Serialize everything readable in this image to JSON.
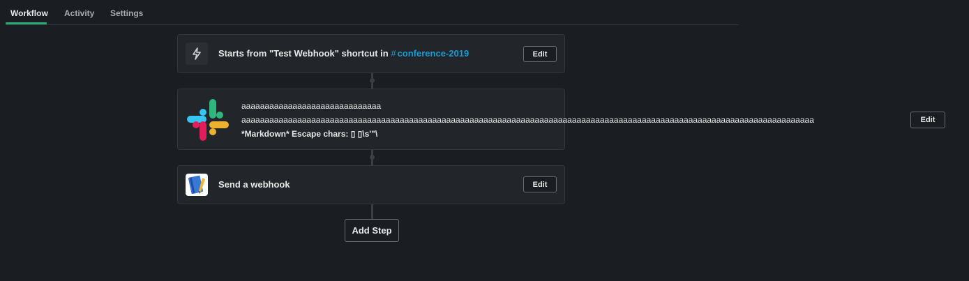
{
  "tabs": [
    {
      "label": "Workflow",
      "active": true
    },
    {
      "label": "Activity",
      "active": false
    },
    {
      "label": "Settings",
      "active": false
    }
  ],
  "steps": [
    {
      "icon": "lightning-bolt-icon",
      "title_prefix": "Starts from \"Test Webhook\" shortcut in",
      "channel_hash": "#",
      "channel_name": "conference-2019",
      "edit_label": "Edit"
    },
    {
      "icon": "slack-logo-icon",
      "lines": [
        "aaaaaaaaaaaaaaaaaaaaaaaaaaaaaa",
        "aaaaaaaaaaaaaaaaaaaaaaaaaaaaaaaaaaaaaaaaaaaaaaaaaaaaaaaaaaaaaaaaaaaaaaaaaaaaaaaaaaaaaaaaaaaaaaaaaaaaaaaaaaaaaaaaaaaaaaaaaaa",
        "*Markdown* Escape chars: ▯ ▯\\s'\"\\"
      ],
      "edit_label": "Edit"
    },
    {
      "icon": "notebook-icon",
      "title": "Send a webhook",
      "edit_label": "Edit"
    }
  ],
  "add_step_label": "Add Step",
  "colors": {
    "background": "#1a1d21",
    "card": "#222529",
    "accent_green": "#2bac76",
    "channel_blue": "#1d9bd1"
  }
}
